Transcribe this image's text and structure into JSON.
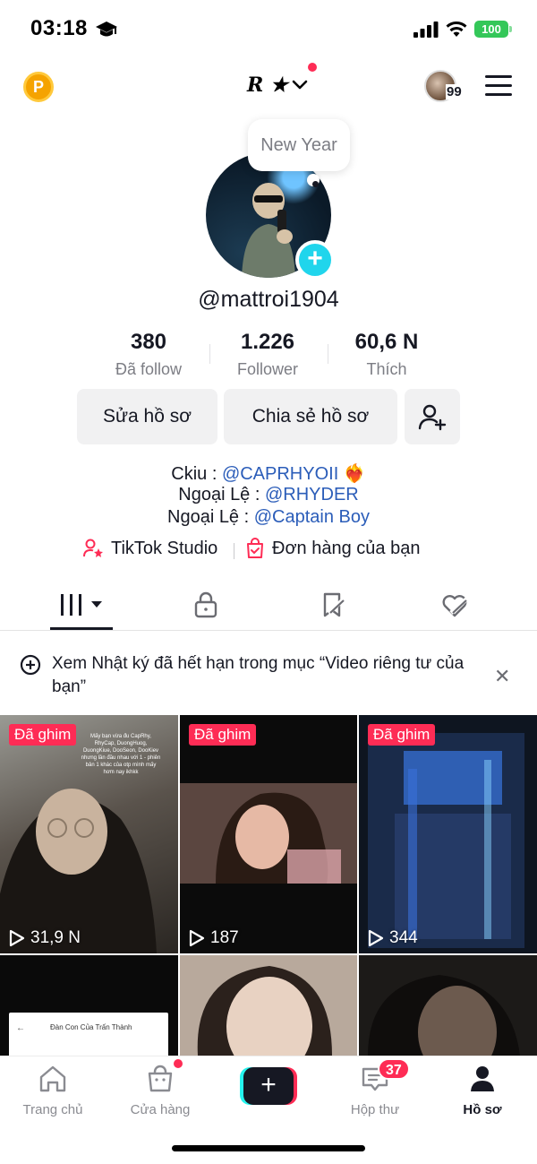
{
  "status_bar": {
    "time": "03:18",
    "battery": "100"
  },
  "top_bar": {
    "coin_label": "P",
    "account_name": "R ★",
    "friends_count": "99"
  },
  "profile": {
    "bubble_note": "New Year",
    "username": "@mattroi1904",
    "stats": [
      {
        "value": "380",
        "label": "Đã follow"
      },
      {
        "value": "1.226",
        "label": "Follower"
      },
      {
        "value": "60,6 N",
        "label": "Thích"
      }
    ],
    "edit_button": "Sửa hồ sơ",
    "share_button": "Chia sẻ hồ sơ",
    "bio": [
      {
        "prefix": "Ckiu : ",
        "mention": "@CAPRHYOII",
        "suffix": " ❤️‍🔥"
      },
      {
        "prefix": "Ngoại Lệ : ",
        "mention": "@RHYDER",
        "suffix": ""
      },
      {
        "prefix": "Ngoại Lệ : ",
        "mention": "@Captain Boy",
        "suffix": ""
      }
    ],
    "studio_link": "TikTok Studio",
    "orders_link": "Đơn hàng của bạn"
  },
  "banner": {
    "text": "Xem Nhật ký đã hết hạn trong mục “Video riêng tư của bạn”",
    "close": "✕"
  },
  "videos": [
    {
      "pinned_label": "Đã ghim",
      "views": "31,9 N",
      "overlay_text": "Mấy bạn vừa đu CapRhy, RhyCap, DuongHuog, DuongKiue, DooSeon, DooKiev nhưng lần đầu nhau với 1 - phiên bản 1 khác của otp mình mấy hơm nay ikhkk"
    },
    {
      "pinned_label": "Đã ghim",
      "views": "187"
    },
    {
      "pinned_label": "Đã ghim",
      "views": "344"
    },
    {
      "doc_title": "Đàn Con Của Trấn Thành"
    },
    {},
    {}
  ],
  "bottom_nav": [
    {
      "label": "Trang chủ",
      "icon": "home-icon"
    },
    {
      "label": "Cửa hàng",
      "icon": "shop-bag-icon"
    },
    {
      "label": "",
      "icon": "create-plus-icon"
    },
    {
      "label": "Hộp thư",
      "icon": "inbox-icon"
    },
    {
      "label": "Hồ sơ",
      "icon": "profile-icon"
    }
  ],
  "inbox_badge": "37",
  "colors": {
    "accent": "#fe2c55",
    "cyan": "#25f4ee",
    "mention": "#2b5db9",
    "text": "#161823",
    "muted": "#7c7d84"
  }
}
